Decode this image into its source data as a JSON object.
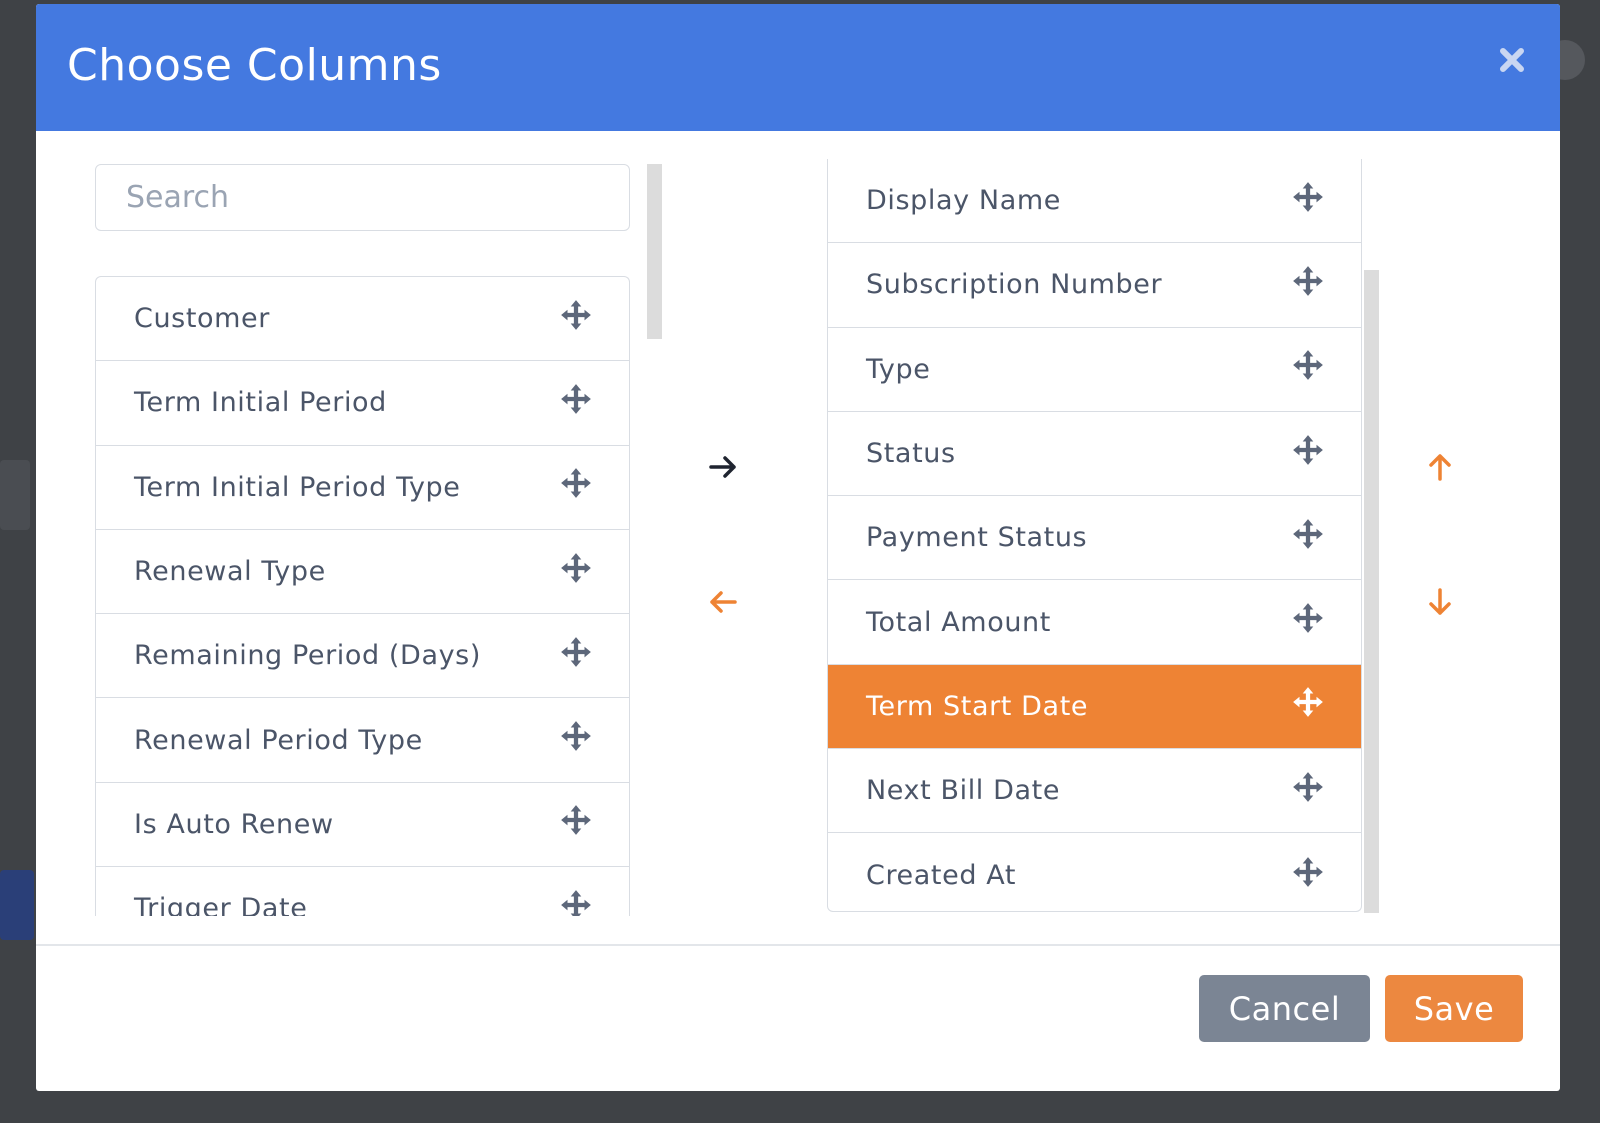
{
  "modal": {
    "title": "Choose Columns",
    "close_icon": "close-icon"
  },
  "search": {
    "placeholder": "Search",
    "value": ""
  },
  "available_columns": [
    {
      "label": "Customer"
    },
    {
      "label": "Term Initial Period"
    },
    {
      "label": "Term Initial Period Type"
    },
    {
      "label": "Renewal Type"
    },
    {
      "label": "Remaining Period (Days)"
    },
    {
      "label": "Renewal Period Type"
    },
    {
      "label": "Is Auto Renew"
    },
    {
      "label": "Trigger Date"
    }
  ],
  "selected_columns": [
    {
      "label": "Display Name"
    },
    {
      "label": "Subscription Number"
    },
    {
      "label": "Type"
    },
    {
      "label": "Status"
    },
    {
      "label": "Payment Status"
    },
    {
      "label": "Total Amount"
    },
    {
      "label": "Term Start Date",
      "active": true
    },
    {
      "label": "Next Bill Date"
    },
    {
      "label": "Created At"
    }
  ],
  "controls": {
    "add_icon": "arrow-right-icon",
    "remove_icon": "arrow-left-icon",
    "move_up_icon": "arrow-up-icon",
    "move_down_icon": "arrow-down-icon",
    "drag_icon": "move-icon"
  },
  "footer": {
    "cancel_label": "Cancel",
    "save_label": "Save"
  },
  "colors": {
    "header": "#4479e0",
    "accent": "#ee8334",
    "cancel": "#7b8594",
    "text": "#4b5568"
  }
}
